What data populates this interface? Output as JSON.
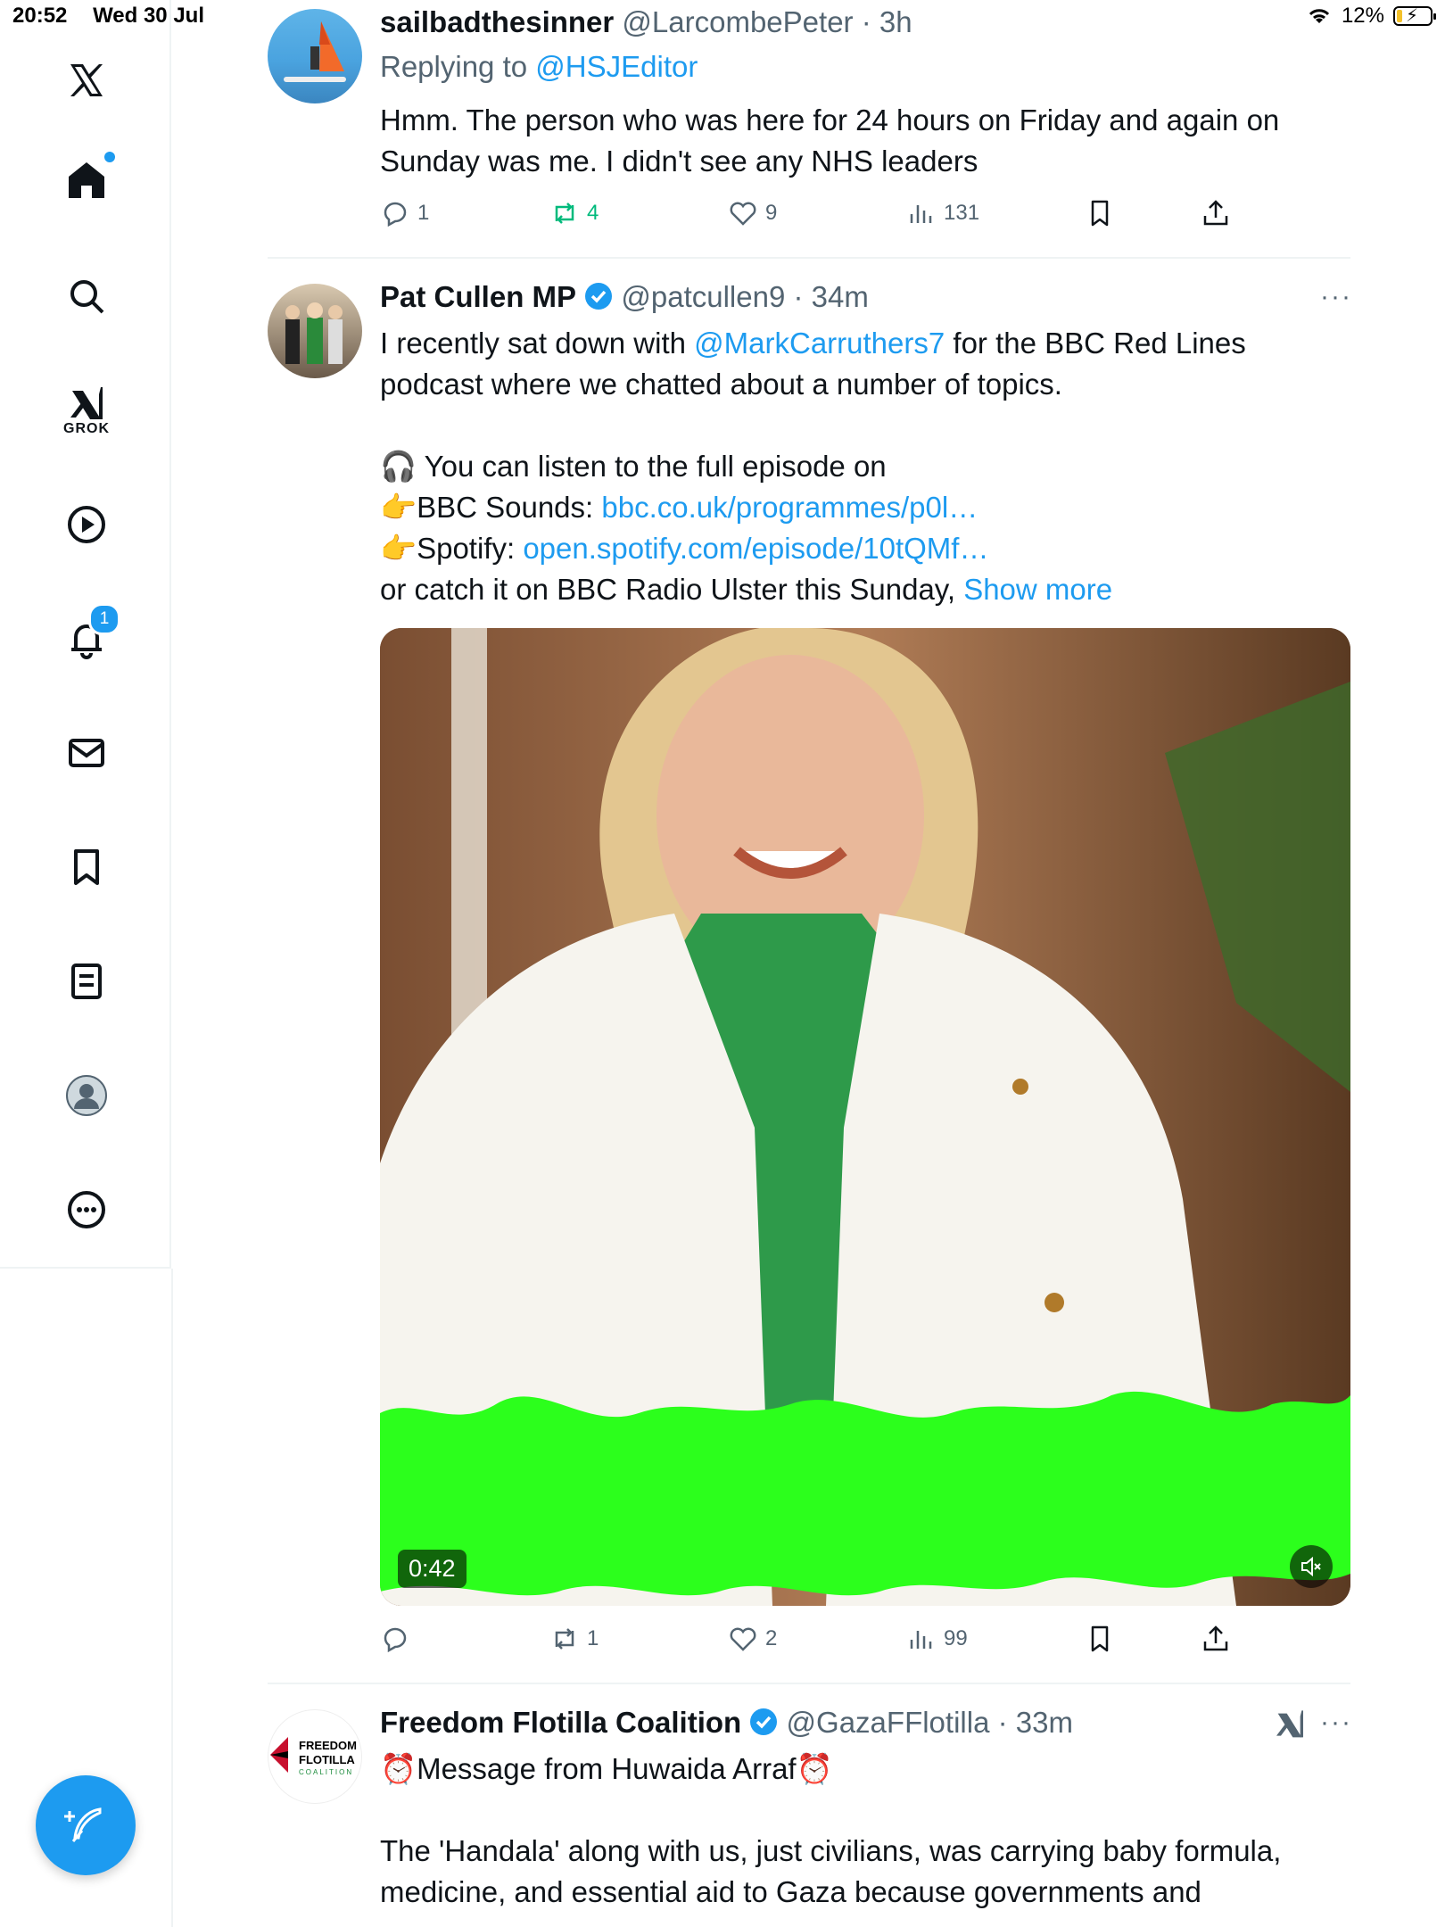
{
  "status_bar": {
    "time": "20:52",
    "date": "Wed 30 Jul",
    "battery": "12%"
  },
  "nav": {
    "items": [
      "x-logo",
      "home",
      "search",
      "grok",
      "video",
      "notifications",
      "messages",
      "bookmarks",
      "lists",
      "profile",
      "more"
    ],
    "grok_label": "GROK",
    "notifications_badge": "1"
  },
  "tweets": [
    {
      "display_name": "sailbadthesinner",
      "handle": "@LarcombePeter",
      "time": "3h",
      "replying_prefix": "Replying to",
      "replying_to": "@HSJEditor",
      "text": "Hmm. The person who was here for 24 hours on Friday and again on Sunday was me. I didn't see any NHS leaders",
      "replies": "1",
      "reposts": "4",
      "likes": "9",
      "views": "131"
    },
    {
      "display_name": "Pat Cullen MP",
      "handle": "@patcullen9",
      "time": "34m",
      "text_1": "I recently sat down with ",
      "mention": "@MarkCarruthers7",
      "text_2": " for the BBC Red Lines podcast where we chatted about a number of topics.",
      "line_listen": "🎧 You can listen to the full episode on",
      "line_sounds_label": "👉BBC Sounds: ",
      "line_sounds_link": "bbc.co.uk/programmes/p0l…",
      "line_spotify_label": "👉Spotify: ",
      "line_spotify_link": "open.spotify.com/episode/10tQMf…",
      "line_radio": "or catch it on BBC Radio Ulster this Sunday, ",
      "show_more": "Show more",
      "video_time": "0:42",
      "replies": "",
      "reposts": "1",
      "likes": "2",
      "views": "99"
    },
    {
      "display_name": "Freedom Flotilla Coalition",
      "handle": "@GazaFFlotilla",
      "time": "33m",
      "avatar_text_1": "FREEDOM",
      "avatar_text_2": "FLOTILLA",
      "avatar_text_3": "COALITION",
      "headline": "⏰Message from Huwaida Arraf⏰",
      "text": "The 'Handala' along with us, just civilians, was carrying baby formula, medicine, and essential aid to Gaza because governments and"
    }
  ],
  "colors": {
    "accent": "#1d9bf0",
    "repost_active": "#00ba7c",
    "waveform": "#2cff1c"
  }
}
